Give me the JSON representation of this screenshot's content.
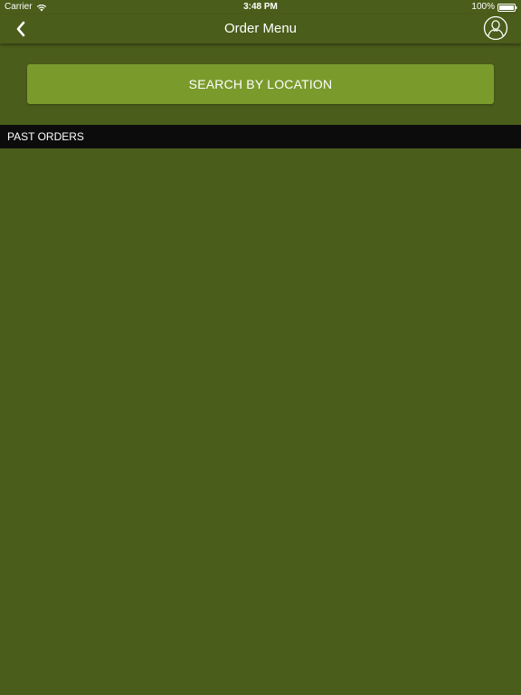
{
  "status_bar": {
    "carrier": "Carrier",
    "time": "3:48 PM",
    "battery": "100%"
  },
  "nav_bar": {
    "title": "Order Menu",
    "back_icon": "chevron-left-icon",
    "profile_icon": "user-circle-icon"
  },
  "search_button": {
    "label": "SEARCH BY LOCATION"
  },
  "past_orders": {
    "header": "PAST ORDERS",
    "items": []
  },
  "colors": {
    "background": "#4a5d1a",
    "button": "#7a9b2c",
    "section_header": "#0c0c0c",
    "text": "#ffffff"
  }
}
